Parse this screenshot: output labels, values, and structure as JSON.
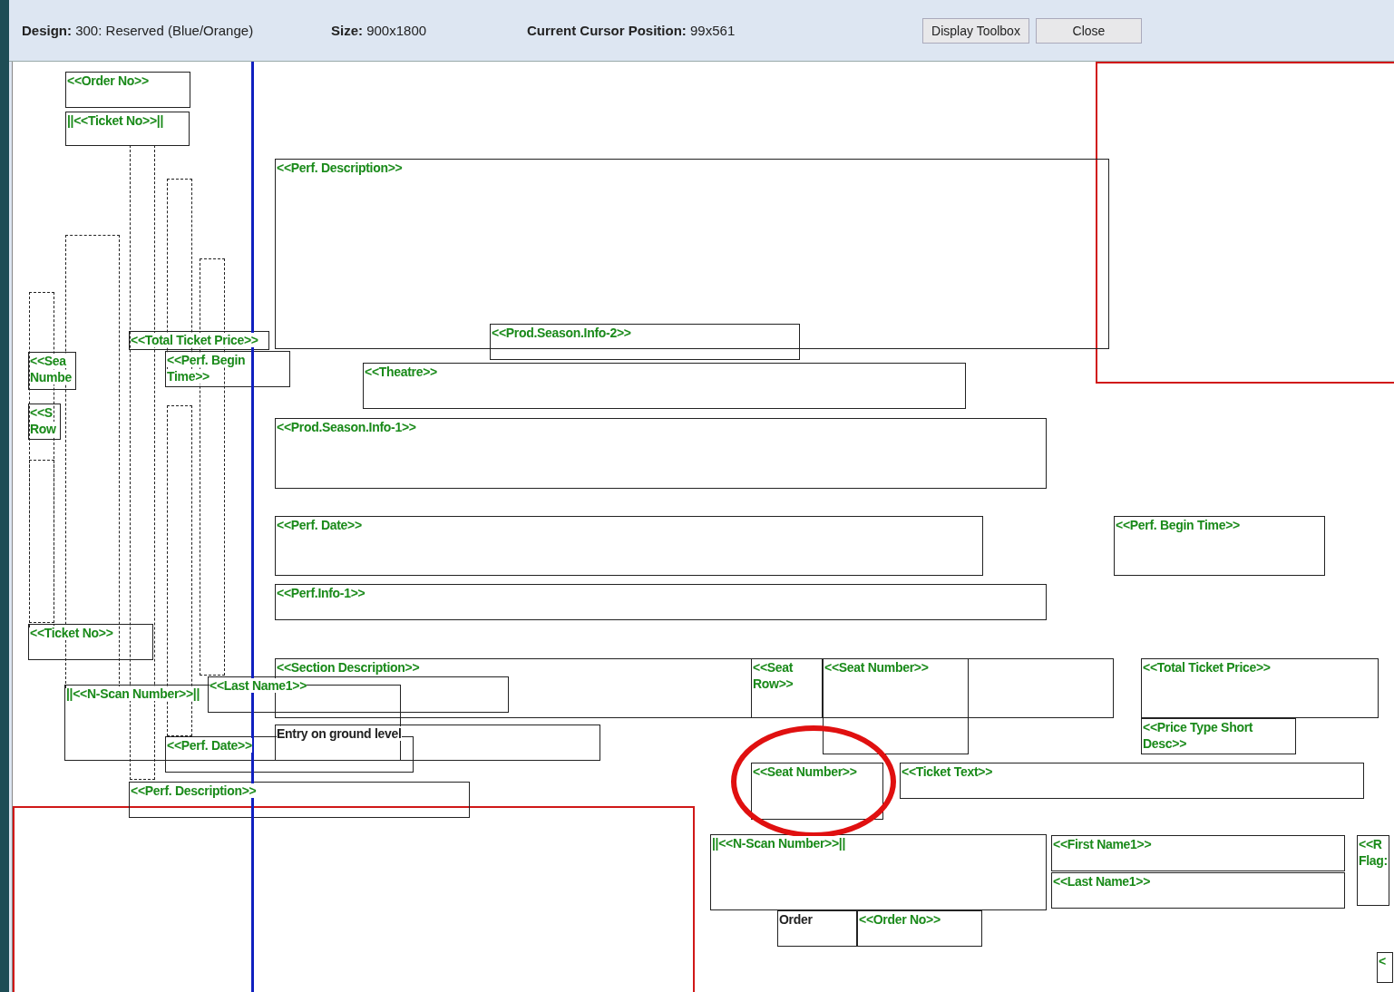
{
  "toolbar": {
    "items": [
      {
        "label": "Design:",
        "value": "300: Reserved (Blue/Orange)"
      },
      {
        "label": "Size:",
        "value": "900x1800"
      },
      {
        "label": "Current Cursor Position:",
        "value": "99x561"
      }
    ],
    "buttons": [
      "Display Toolbox",
      "Close"
    ]
  },
  "fields": [
    {
      "kind": "field",
      "text": "<<Order No>>"
    },
    {
      "kind": "field",
      "text": "||<<Ticket No>>||"
    },
    {
      "kind": "field",
      "text": "<<Perf. Description>>"
    },
    {
      "kind": "field",
      "text": "<<Prod.Season.Info-2>>"
    },
    {
      "kind": "field",
      "text": "<<Theatre>>"
    },
    {
      "kind": "field",
      "text": "<<Prod.Season.Info-1>>"
    },
    {
      "kind": "field",
      "text": "<<Perf. Date>>"
    },
    {
      "kind": "field",
      "text": "<<Perf. Begin Time>>"
    },
    {
      "kind": "field",
      "text": "<<Perf.Info-1>>"
    },
    {
      "kind": "field",
      "text": "<<Sea Numbe"
    },
    {
      "kind": "field",
      "text": "<<S Row"
    },
    {
      "kind": "field",
      "text": "<<Total Ticket Price>>"
    },
    {
      "kind": "field",
      "text": "<<Perf. Begin Time>>"
    },
    {
      "kind": "field",
      "text": "<<Ticket No>>"
    },
    {
      "kind": "field",
      "text": "<<Section Description>>"
    },
    {
      "kind": "field",
      "text": "<<Last Name1>>"
    },
    {
      "kind": "field",
      "text": "||<<N-Scan Number>>||"
    },
    {
      "kind": "static",
      "text": "Entry on ground level"
    },
    {
      "kind": "field",
      "text": "<<Perf. Date>>"
    },
    {
      "kind": "field",
      "text": "<<Perf. Description>>"
    },
    {
      "kind": "field",
      "text": "<<Seat Row>>"
    },
    {
      "kind": "field",
      "text": "<<Seat Number>>"
    },
    {
      "kind": "field",
      "text": "<<Total Ticket Price>>"
    },
    {
      "kind": "field",
      "text": "<<Price Type Short Desc>>"
    },
    {
      "kind": "field",
      "text": "<<Seat Number>>"
    },
    {
      "kind": "field",
      "text": "<<Ticket Text>>"
    },
    {
      "kind": "field",
      "text": "||<<N-Scan Number>>||"
    },
    {
      "kind": "field",
      "text": "<<First Name1>>"
    },
    {
      "kind": "field",
      "text": "<<Last Name1>>"
    },
    {
      "kind": "field",
      "text": "<<R Flag:"
    },
    {
      "kind": "static",
      "text": "Order"
    },
    {
      "kind": "field",
      "text": "<<Order No>>"
    },
    {
      "kind": "field",
      "text": "<"
    }
  ]
}
